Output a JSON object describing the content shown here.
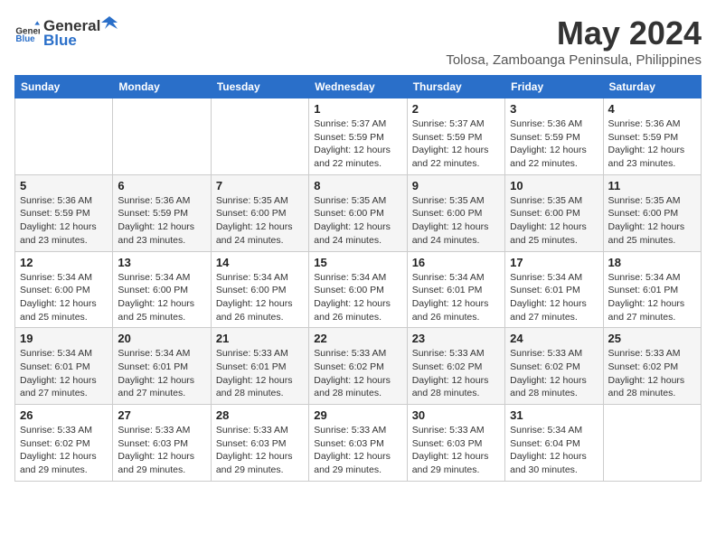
{
  "logo": {
    "general": "General",
    "blue": "Blue"
  },
  "title": "May 2024",
  "location": "Tolosa, Zamboanga Peninsula, Philippines",
  "days_of_week": [
    "Sunday",
    "Monday",
    "Tuesday",
    "Wednesday",
    "Thursday",
    "Friday",
    "Saturday"
  ],
  "weeks": [
    [
      {
        "day": "",
        "info": ""
      },
      {
        "day": "",
        "info": ""
      },
      {
        "day": "",
        "info": ""
      },
      {
        "day": "1",
        "info": "Sunrise: 5:37 AM\nSunset: 5:59 PM\nDaylight: 12 hours and 22 minutes."
      },
      {
        "day": "2",
        "info": "Sunrise: 5:37 AM\nSunset: 5:59 PM\nDaylight: 12 hours and 22 minutes."
      },
      {
        "day": "3",
        "info": "Sunrise: 5:36 AM\nSunset: 5:59 PM\nDaylight: 12 hours and 22 minutes."
      },
      {
        "day": "4",
        "info": "Sunrise: 5:36 AM\nSunset: 5:59 PM\nDaylight: 12 hours and 23 minutes."
      }
    ],
    [
      {
        "day": "5",
        "info": "Sunrise: 5:36 AM\nSunset: 5:59 PM\nDaylight: 12 hours and 23 minutes."
      },
      {
        "day": "6",
        "info": "Sunrise: 5:36 AM\nSunset: 5:59 PM\nDaylight: 12 hours and 23 minutes."
      },
      {
        "day": "7",
        "info": "Sunrise: 5:35 AM\nSunset: 6:00 PM\nDaylight: 12 hours and 24 minutes."
      },
      {
        "day": "8",
        "info": "Sunrise: 5:35 AM\nSunset: 6:00 PM\nDaylight: 12 hours and 24 minutes."
      },
      {
        "day": "9",
        "info": "Sunrise: 5:35 AM\nSunset: 6:00 PM\nDaylight: 12 hours and 24 minutes."
      },
      {
        "day": "10",
        "info": "Sunrise: 5:35 AM\nSunset: 6:00 PM\nDaylight: 12 hours and 25 minutes."
      },
      {
        "day": "11",
        "info": "Sunrise: 5:35 AM\nSunset: 6:00 PM\nDaylight: 12 hours and 25 minutes."
      }
    ],
    [
      {
        "day": "12",
        "info": "Sunrise: 5:34 AM\nSunset: 6:00 PM\nDaylight: 12 hours and 25 minutes."
      },
      {
        "day": "13",
        "info": "Sunrise: 5:34 AM\nSunset: 6:00 PM\nDaylight: 12 hours and 25 minutes."
      },
      {
        "day": "14",
        "info": "Sunrise: 5:34 AM\nSunset: 6:00 PM\nDaylight: 12 hours and 26 minutes."
      },
      {
        "day": "15",
        "info": "Sunrise: 5:34 AM\nSunset: 6:00 PM\nDaylight: 12 hours and 26 minutes."
      },
      {
        "day": "16",
        "info": "Sunrise: 5:34 AM\nSunset: 6:01 PM\nDaylight: 12 hours and 26 minutes."
      },
      {
        "day": "17",
        "info": "Sunrise: 5:34 AM\nSunset: 6:01 PM\nDaylight: 12 hours and 27 minutes."
      },
      {
        "day": "18",
        "info": "Sunrise: 5:34 AM\nSunset: 6:01 PM\nDaylight: 12 hours and 27 minutes."
      }
    ],
    [
      {
        "day": "19",
        "info": "Sunrise: 5:34 AM\nSunset: 6:01 PM\nDaylight: 12 hours and 27 minutes."
      },
      {
        "day": "20",
        "info": "Sunrise: 5:34 AM\nSunset: 6:01 PM\nDaylight: 12 hours and 27 minutes."
      },
      {
        "day": "21",
        "info": "Sunrise: 5:33 AM\nSunset: 6:01 PM\nDaylight: 12 hours and 28 minutes."
      },
      {
        "day": "22",
        "info": "Sunrise: 5:33 AM\nSunset: 6:02 PM\nDaylight: 12 hours and 28 minutes."
      },
      {
        "day": "23",
        "info": "Sunrise: 5:33 AM\nSunset: 6:02 PM\nDaylight: 12 hours and 28 minutes."
      },
      {
        "day": "24",
        "info": "Sunrise: 5:33 AM\nSunset: 6:02 PM\nDaylight: 12 hours and 28 minutes."
      },
      {
        "day": "25",
        "info": "Sunrise: 5:33 AM\nSunset: 6:02 PM\nDaylight: 12 hours and 28 minutes."
      }
    ],
    [
      {
        "day": "26",
        "info": "Sunrise: 5:33 AM\nSunset: 6:02 PM\nDaylight: 12 hours and 29 minutes."
      },
      {
        "day": "27",
        "info": "Sunrise: 5:33 AM\nSunset: 6:03 PM\nDaylight: 12 hours and 29 minutes."
      },
      {
        "day": "28",
        "info": "Sunrise: 5:33 AM\nSunset: 6:03 PM\nDaylight: 12 hours and 29 minutes."
      },
      {
        "day": "29",
        "info": "Sunrise: 5:33 AM\nSunset: 6:03 PM\nDaylight: 12 hours and 29 minutes."
      },
      {
        "day": "30",
        "info": "Sunrise: 5:33 AM\nSunset: 6:03 PM\nDaylight: 12 hours and 29 minutes."
      },
      {
        "day": "31",
        "info": "Sunrise: 5:34 AM\nSunset: 6:04 PM\nDaylight: 12 hours and 30 minutes."
      },
      {
        "day": "",
        "info": ""
      }
    ]
  ]
}
